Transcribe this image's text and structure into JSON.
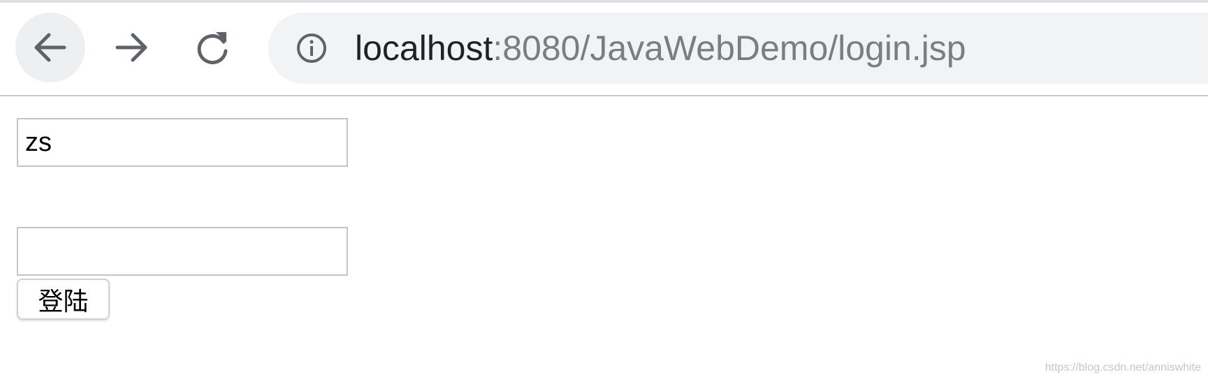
{
  "browser": {
    "back_icon": "arrow-left-icon",
    "forward_icon": "arrow-right-icon",
    "reload_icon": "reload-icon",
    "site_info_icon": "info-circle-icon",
    "url_host": "localhost",
    "url_path": ":8080/JavaWebDemo/login.jsp"
  },
  "form": {
    "username_value": "zs",
    "password_value": "",
    "submit_label": "登陆"
  },
  "watermark": "https://blog.csdn.net/anniswhite",
  "colors": {
    "toolbar_bg": "#ffffff",
    "omnibox_bg": "#f1f3f4",
    "url_host": "#202124",
    "url_path": "#7a7d81",
    "icon": "#5f6368"
  }
}
